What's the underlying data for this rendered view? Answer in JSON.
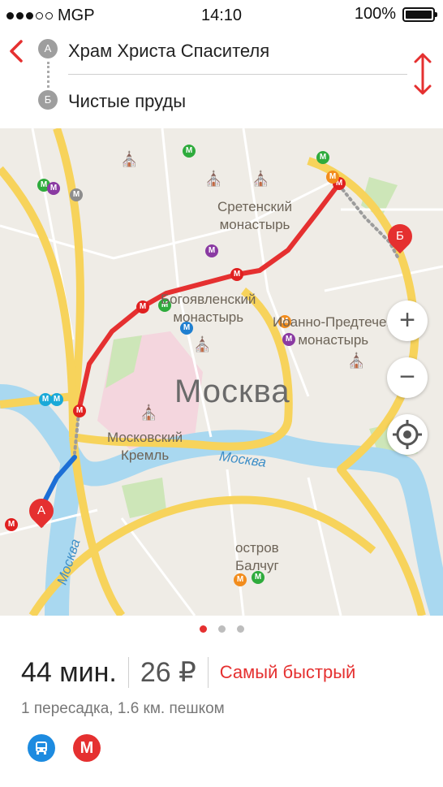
{
  "status": {
    "carrier": "MGP",
    "time": "14:10",
    "battery": "100%",
    "signal_bars_filled": 3,
    "signal_bars_total": 5
  },
  "route": {
    "from": "Храм Христа Спасителя",
    "to": "Чистые пруды",
    "from_marker": "А",
    "to_marker": "Б"
  },
  "map": {
    "city_label": "Москва",
    "labels": {
      "sretensky": "Сретенский\nмонастырь",
      "bogoyavlensky": "Богоявленский\nмонастырь",
      "ivanovo": "Иоанно-Предтечев\nмонастырь",
      "kremlin": "Московский\nКремль",
      "balchug": "остров\nБалчуг",
      "river_1": "Москва",
      "river_2": "Москва"
    },
    "pin_a": "А",
    "pin_b": "Б",
    "zoom_in": "+",
    "zoom_out": "−"
  },
  "pager": {
    "pages": 3,
    "active": 0
  },
  "summary": {
    "duration": "44 мин.",
    "price": "26 ₽",
    "tag": "Самый быстрый",
    "details": "1 пересадка, 1.6 км. пешком",
    "metro_letter": "М"
  },
  "colors": {
    "accent": "#e53030",
    "route_metro": "#e53030",
    "route_bus": "#1d6fd6",
    "road": "#f7d35b",
    "river": "#a9d8f0"
  },
  "icons": [
    "back-chevron-icon",
    "swap-arrows-icon",
    "locate-icon",
    "bus-icon",
    "metro-icon",
    "church-icon"
  ]
}
